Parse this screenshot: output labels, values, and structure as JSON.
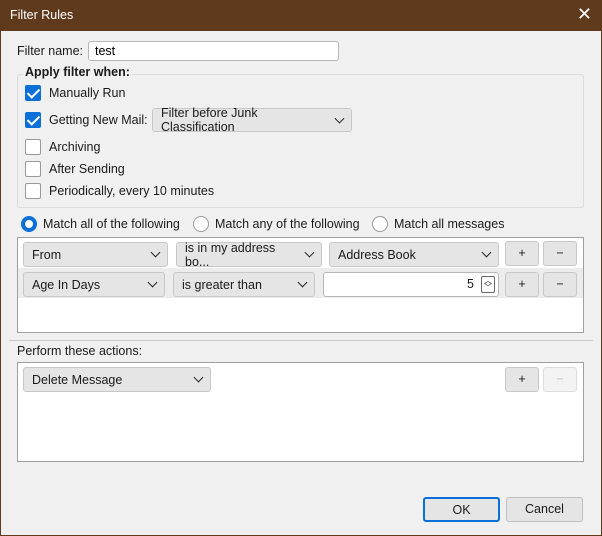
{
  "window": {
    "title": "Filter Rules"
  },
  "filter_name": {
    "label": "Filter name:",
    "value": "test"
  },
  "apply": {
    "heading": "Apply filter when:",
    "manual": {
      "label": "Manually Run",
      "checked": true
    },
    "new_mail": {
      "label": "Getting New Mail:",
      "checked": true,
      "option": "Filter before Junk Classification"
    },
    "archiving": {
      "label": "Archiving",
      "checked": false
    },
    "after_sending": {
      "label": "After Sending",
      "checked": false
    },
    "periodic": {
      "label": "Periodically, every 10 minutes",
      "checked": false
    }
  },
  "match": {
    "all": "Match all of the following",
    "any": "Match any of the following",
    "messages": "Match all messages",
    "selected": "all"
  },
  "rules": [
    {
      "field": "From",
      "op": "is in my address bo...",
      "value": "Address Book"
    },
    {
      "field": "Age In Days",
      "op": "is greater than",
      "value": "5"
    }
  ],
  "buttons": {
    "plus": "+",
    "minus": "−",
    "ok": "OK",
    "cancel": "Cancel"
  },
  "actions": {
    "heading": "Perform these actions:",
    "items": [
      {
        "action": "Delete Message"
      }
    ]
  }
}
